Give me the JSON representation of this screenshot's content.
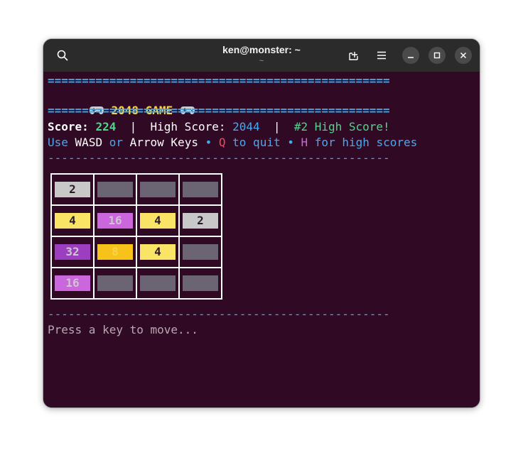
{
  "window": {
    "title": "ken@monster: ~",
    "subtitle": "~"
  },
  "terminal": {
    "rule_eq": "==================================================",
    "rule_dash": "--------------------------------------------------",
    "game_title": "2048 GAME",
    "score_label": "Score:",
    "score_value": "224",
    "separator": "|",
    "high_score_label": "High Score:",
    "high_score_value": "2044",
    "rank_text": "#2 High Score!",
    "help": {
      "use": "Use",
      "wasd": "WASD",
      "or": "or",
      "arrow_keys": "Arrow Keys",
      "bullet": "•",
      "q": "Q",
      "to_quit": "to quit",
      "h": "H",
      "for_high_scores": "for high scores"
    },
    "prompt": "Press a key to move..."
  },
  "board": {
    "rows": [
      [
        "2",
        "",
        "",
        ""
      ],
      [
        "4",
        "16",
        "4",
        "2"
      ],
      [
        "32",
        "8",
        "4",
        ""
      ],
      [
        "16",
        "",
        "",
        ""
      ]
    ],
    "tile_colors": {
      "empty": "#6b6472",
      "2": "#c8c8c8",
      "4": "#f9e466",
      "8": "#f7c21a",
      "16": "#cc66dd",
      "32": "#9b3fc0"
    },
    "text_colors": {
      "2": "#2a1a2a",
      "4": "#2a1a2a",
      "8": "#f7d44a",
      "16": "#cfc4d0",
      "32": "#cfc4d0"
    }
  },
  "colors": {
    "terminal_bg": "#300a24",
    "titlebar_bg": "#2b2b2b",
    "accent_blue": "#3aa8e8",
    "yellow": "#f7d44a",
    "green": "#4fd68a",
    "red": "#ee4a5a",
    "magenta": "#cc66dd"
  },
  "icons": {
    "search": "search-icon",
    "new_tab": "new-tab-icon",
    "menu": "hamburger-menu-icon",
    "minimize": "minimize-icon",
    "maximize": "maximize-icon",
    "close": "close-icon",
    "gamepad": "gamepad-icon"
  }
}
